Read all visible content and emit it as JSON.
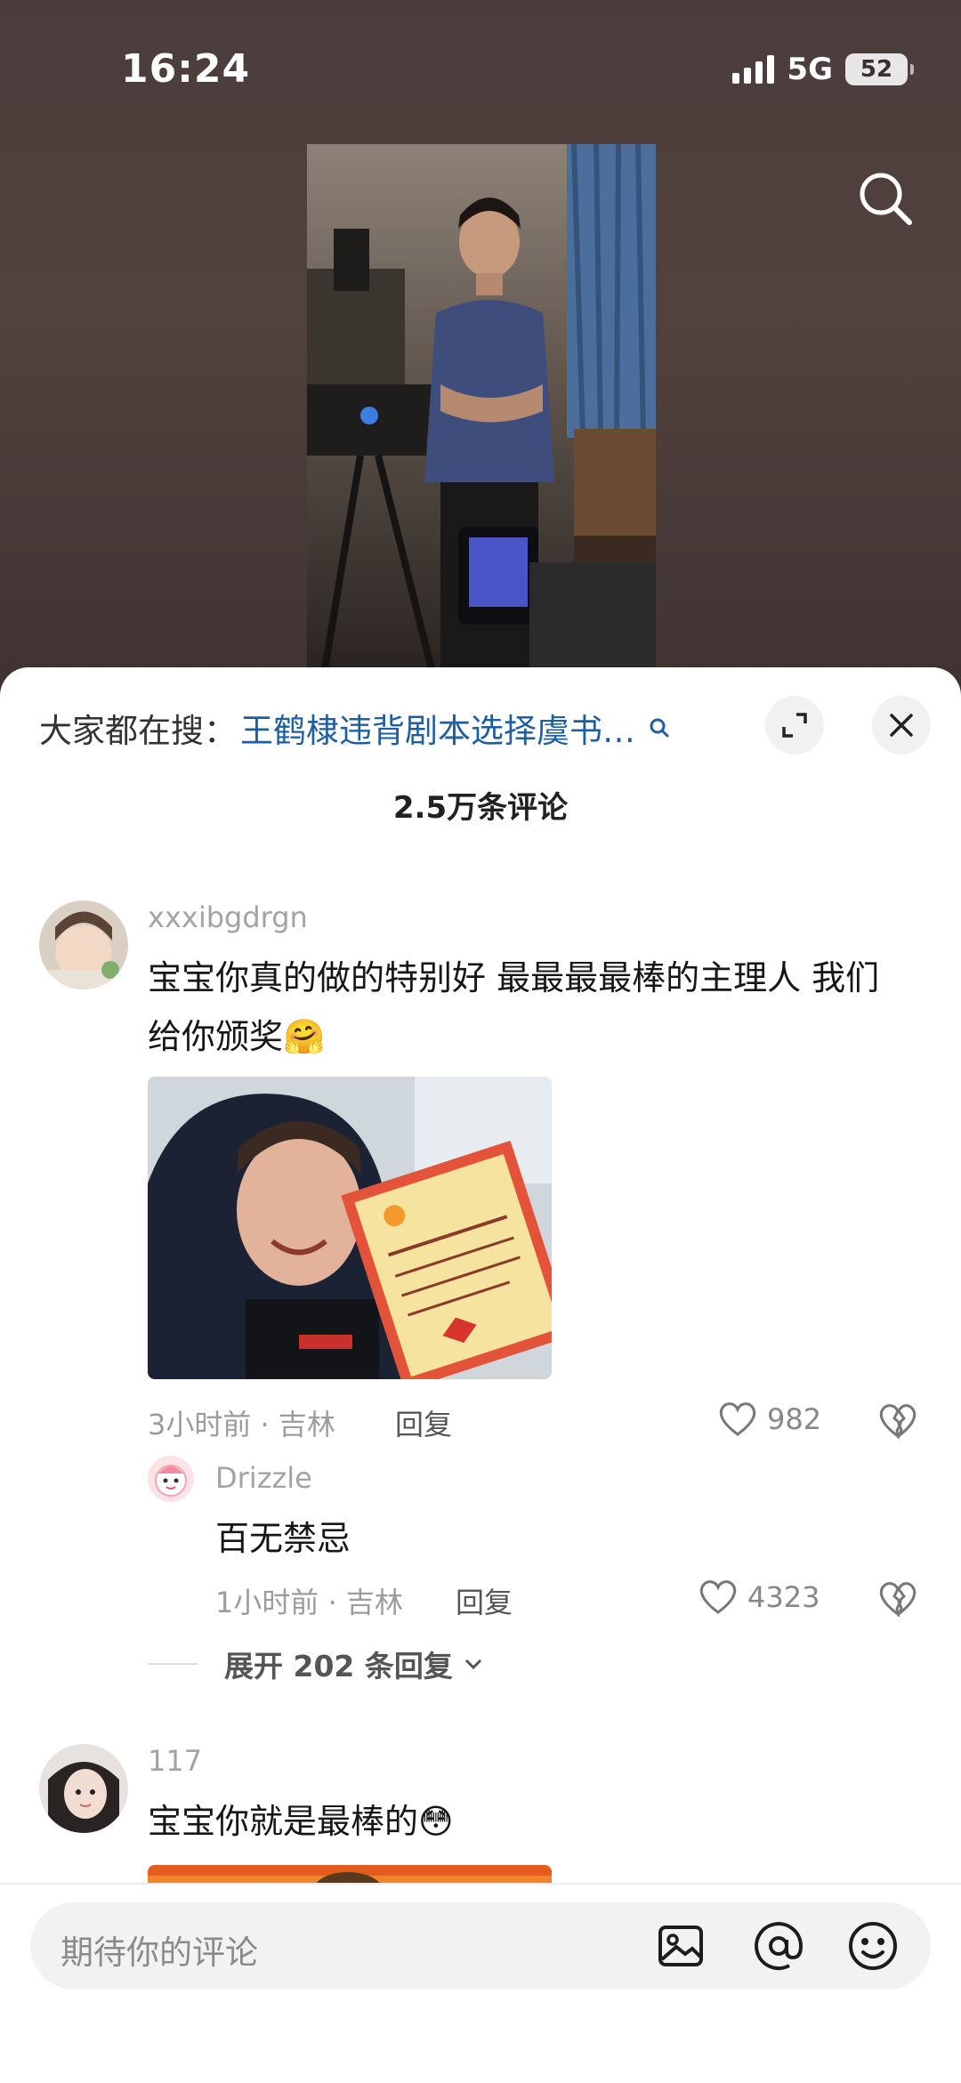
{
  "status": {
    "time": "16:24",
    "network": "5G",
    "battery": "52"
  },
  "sheet": {
    "hot_search_prefix": "大家都在搜：",
    "hot_search_link": "王鹤棣违背剧本选择虞书…",
    "comment_count": "2.5万条评论"
  },
  "comments": [
    {
      "username": "xxxibgdrgn",
      "text_line1": "宝宝你真的做的特别好 最最最最棒的主理人 我们",
      "text_line2": "给你颁奖🤗",
      "meta": "3小时前 · 吉林",
      "reply_label": "回复",
      "likes": "982",
      "replies": [
        {
          "username": "Drizzle",
          "text": "百无禁忌",
          "meta": "1小时前 · 吉林",
          "reply_label": "回复",
          "likes": "4323"
        }
      ],
      "expand_label": "展开 202 条回复"
    },
    {
      "username": "117",
      "text": "宝宝你就是最棒的😳"
    }
  ],
  "input": {
    "placeholder": "期待你的评论"
  },
  "colors": {
    "link": "#1f5fa0",
    "background_top": "#4b3f3d"
  },
  "icons": [
    "search-icon",
    "expand-icon",
    "close-icon",
    "heart-icon",
    "broken-heart-icon",
    "chevron-down-icon",
    "image-icon",
    "at-icon",
    "emoji-icon"
  ]
}
